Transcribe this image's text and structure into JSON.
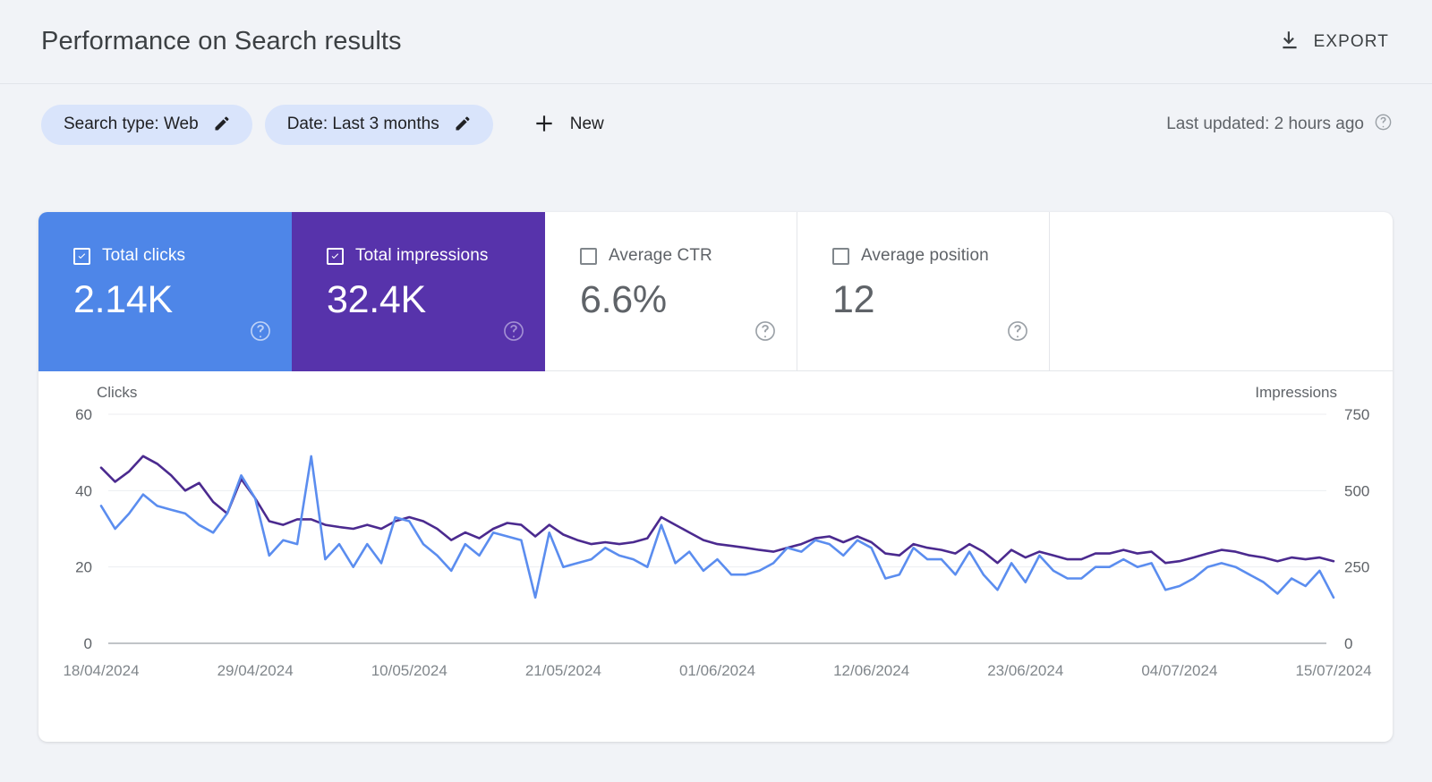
{
  "header": {
    "title": "Performance on Search results",
    "export_label": "EXPORT",
    "export_icon": "download-icon"
  },
  "filters": {
    "chips": [
      {
        "label": "Search type: Web",
        "icon": "pencil-icon"
      },
      {
        "label": "Date: Last 3 months",
        "icon": "pencil-icon"
      }
    ],
    "new_label": "New",
    "new_icon": "plus-icon",
    "last_updated": "Last updated: 2 hours ago",
    "help_icon": "help-circle-icon"
  },
  "metrics": [
    {
      "name": "Total clicks",
      "value": "2.14K",
      "checked": true,
      "style": "clicks",
      "color": "#4e86e8",
      "help_icon": "help-circle-icon"
    },
    {
      "name": "Total impressions",
      "value": "32.4K",
      "checked": true,
      "style": "impressions",
      "color": "#5733ab",
      "help_icon": "help-circle-icon"
    },
    {
      "name": "Average CTR",
      "value": "6.6%",
      "checked": false,
      "style": "plain",
      "color": "#ffffff",
      "help_icon": "help-circle-icon"
    },
    {
      "name": "Average position",
      "value": "12",
      "checked": false,
      "style": "plain",
      "color": "#ffffff",
      "help_icon": "help-circle-icon"
    }
  ],
  "chart_data": {
    "type": "line",
    "title": "",
    "ylabel": "Clicks",
    "ylabel_right": "Impressions",
    "xlabel": "",
    "ylim": [
      0,
      60
    ],
    "ylim_right": [
      0,
      750
    ],
    "yticks": [
      60,
      40,
      20,
      0
    ],
    "yticks_right": [
      750,
      500,
      250,
      0
    ],
    "grid": true,
    "legend": "none",
    "x_tick_labels": [
      "18/04/2024",
      "29/04/2024",
      "10/05/2024",
      "21/05/2024",
      "01/06/2024",
      "12/06/2024",
      "23/06/2024",
      "04/07/2024",
      "15/07/2024"
    ],
    "x_tick_indices": [
      0,
      11,
      22,
      33,
      44,
      55,
      66,
      77,
      88
    ],
    "series": [
      {
        "name": "Total clicks",
        "color": "#5b8def",
        "axis": "left",
        "values": [
          36,
          30,
          34,
          39,
          36,
          35,
          34,
          31,
          29,
          34,
          44,
          38,
          23,
          27,
          26,
          49,
          22,
          26,
          20,
          26,
          21,
          33,
          32,
          26,
          23,
          19,
          26,
          23,
          29,
          28,
          27,
          12,
          29,
          20,
          21,
          22,
          25,
          23,
          22,
          20,
          31,
          21,
          24,
          19,
          22,
          18,
          18,
          19,
          21,
          25,
          24,
          27,
          26,
          23,
          27,
          25,
          17,
          18,
          25,
          22,
          22,
          18,
          24,
          18,
          14,
          21,
          16,
          23,
          19,
          17,
          17,
          20,
          20,
          22,
          20,
          21,
          14,
          15,
          17,
          20,
          21,
          20,
          18,
          16,
          13,
          17,
          15,
          19,
          12
        ]
      },
      {
        "name": "Total impressions",
        "color": "#4b2a8f",
        "axis": "right",
        "values": [
          575,
          529,
          563,
          613,
          588,
          550,
          500,
          525,
          463,
          425,
          538,
          475,
          400,
          388,
          406,
          406,
          388,
          381,
          375,
          388,
          375,
          400,
          413,
          400,
          375,
          338,
          363,
          344,
          375,
          394,
          388,
          350,
          388,
          356,
          338,
          325,
          331,
          325,
          331,
          344,
          413,
          388,
          363,
          338,
          325,
          319,
          313,
          306,
          300,
          313,
          325,
          344,
          350,
          331,
          350,
          331,
          294,
          288,
          325,
          313,
          306,
          294,
          325,
          300,
          263,
          306,
          281,
          300,
          288,
          275,
          275,
          294,
          294,
          306,
          294,
          300,
          263,
          269,
          281,
          294,
          306,
          300,
          288,
          281,
          269,
          281,
          275,
          281,
          269
        ]
      }
    ]
  }
}
